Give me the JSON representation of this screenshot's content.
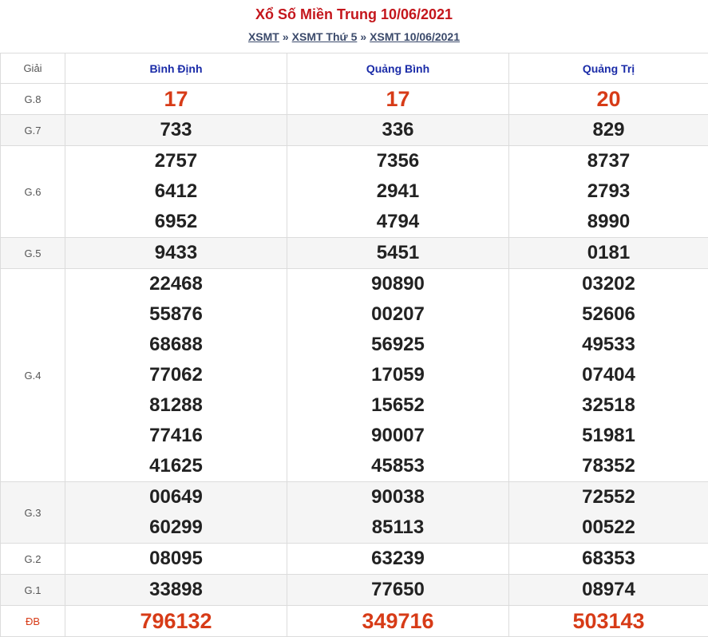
{
  "header": {
    "title": "Xổ Số Miền Trung 10/06/2021",
    "crumbs": [
      "XSMT",
      "XSMT Thứ 5",
      "XSMT 10/06/2021"
    ],
    "separator": "»"
  },
  "table": {
    "col_label": "Giải",
    "provinces": [
      "Bình Định",
      "Quảng Bình",
      "Quảng Trị"
    ],
    "rows": [
      {
        "label": "G.8",
        "values": [
          [
            "17"
          ],
          [
            "17"
          ],
          [
            "20"
          ]
        ]
      },
      {
        "label": "G.7",
        "values": [
          [
            "733"
          ],
          [
            "336"
          ],
          [
            "829"
          ]
        ]
      },
      {
        "label": "G.6",
        "values": [
          [
            "2757",
            "6412",
            "6952"
          ],
          [
            "7356",
            "2941",
            "4794"
          ],
          [
            "8737",
            "2793",
            "8990"
          ]
        ]
      },
      {
        "label": "G.5",
        "values": [
          [
            "9433"
          ],
          [
            "5451"
          ],
          [
            "0181"
          ]
        ]
      },
      {
        "label": "G.4",
        "values": [
          [
            "22468",
            "55876",
            "68688",
            "77062",
            "81288",
            "77416",
            "41625"
          ],
          [
            "90890",
            "00207",
            "56925",
            "17059",
            "15652",
            "90007",
            "45853"
          ],
          [
            "03202",
            "52606",
            "49533",
            "07404",
            "32518",
            "51981",
            "78352"
          ]
        ]
      },
      {
        "label": "G.3",
        "values": [
          [
            "00649",
            "60299"
          ],
          [
            "90038",
            "85113"
          ],
          [
            "72552",
            "00522"
          ]
        ]
      },
      {
        "label": "G.2",
        "values": [
          [
            "08095"
          ],
          [
            "63239"
          ],
          [
            "68353"
          ]
        ]
      },
      {
        "label": "G.1",
        "values": [
          [
            "33898"
          ],
          [
            "77650"
          ],
          [
            "08974"
          ]
        ]
      },
      {
        "label": "ĐB",
        "values": [
          [
            "796132"
          ],
          [
            "349716"
          ],
          [
            "503143"
          ]
        ]
      }
    ]
  },
  "colors": {
    "title": "#c4161c",
    "highlight": "#d73b17",
    "province": "#1b2ca8"
  }
}
